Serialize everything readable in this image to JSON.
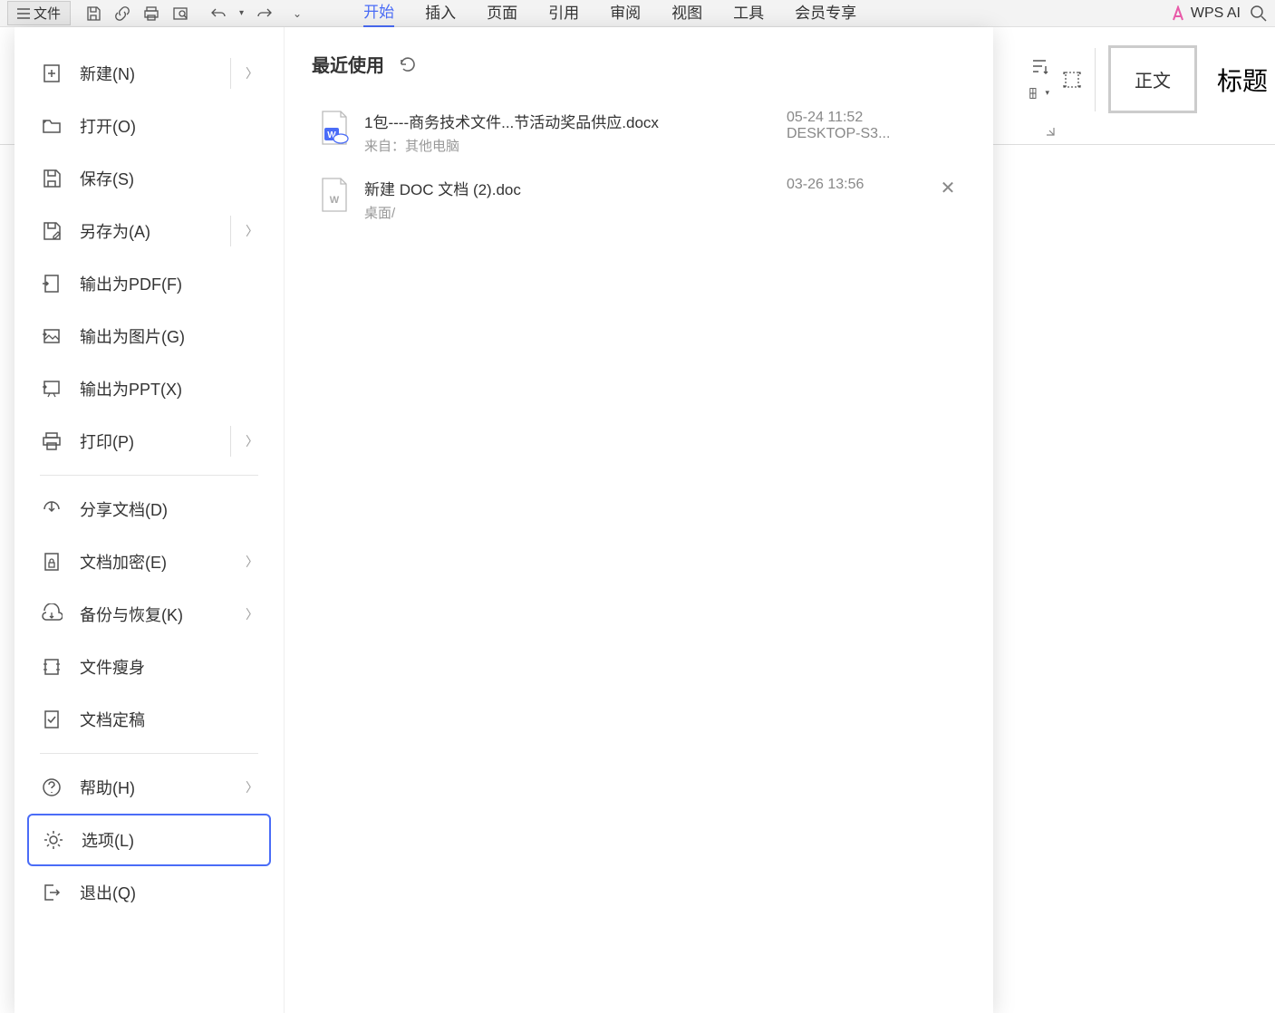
{
  "topbar": {
    "file_label": "文件"
  },
  "ribbon_tabs": {
    "start": "开始",
    "insert": "插入",
    "page": "页面",
    "reference": "引用",
    "review": "审阅",
    "view": "视图",
    "tools": "工具",
    "member": "会员专享"
  },
  "top_right": {
    "wps_ai": "WPS AI"
  },
  "ribbon_styles": {
    "body": "正文",
    "heading": "标题"
  },
  "file_menu": {
    "new": "新建(N)",
    "open": "打开(O)",
    "save": "保存(S)",
    "save_as": "另存为(A)",
    "export_pdf": "输出为PDF(F)",
    "export_image": "输出为图片(G)",
    "export_ppt": "输出为PPT(X)",
    "print": "打印(P)",
    "share": "分享文档(D)",
    "encrypt": "文档加密(E)",
    "backup": "备份与恢复(K)",
    "slim": "文件瘦身",
    "finalize": "文档定稿",
    "help": "帮助(H)",
    "options": "选项(L)",
    "exit": "退出(Q)"
  },
  "recent": {
    "header": "最近使用",
    "files": [
      {
        "name": "1包----商务技术文件...节活动奖品供应.docx",
        "source": "来自：其他电脑",
        "time": "05-24 11:52",
        "device": "DESKTOP-S3..."
      },
      {
        "name": "新建 DOC 文档 (2).doc",
        "source": "桌面/",
        "time": "03-26 13:56",
        "device": ""
      }
    ]
  }
}
